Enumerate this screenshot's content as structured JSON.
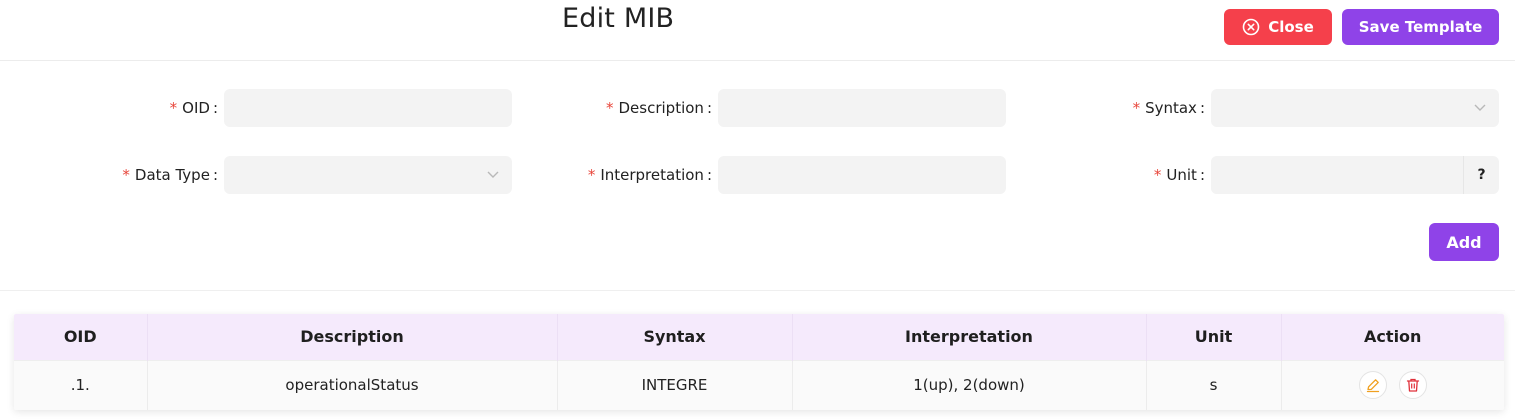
{
  "header": {
    "title": "Edit MIB",
    "close_label": "Close",
    "save_label": "Save Template"
  },
  "form": {
    "oid": {
      "label": "OID",
      "value": ""
    },
    "description": {
      "label": "Description",
      "value": ""
    },
    "syntax": {
      "label": "Syntax",
      "value": ""
    },
    "data_type": {
      "label": "Data Type",
      "value": ""
    },
    "interpretation": {
      "label": "Interpretation",
      "value": ""
    },
    "unit": {
      "label": "Unit",
      "value": "",
      "suffix": "?"
    },
    "required_mark": "*",
    "add_label": "Add"
  },
  "table": {
    "columns": [
      "OID",
      "Description",
      "Syntax",
      "Interpretation",
      "Unit",
      "Action"
    ],
    "rows": [
      {
        "oid": ".1.",
        "description": "operationalStatus",
        "syntax": "INTEGRE",
        "interpretation": "1(up), 2(down)",
        "unit": "s"
      }
    ]
  },
  "colors": {
    "danger": "#f5404b",
    "primary": "#8f43e8",
    "header_bg": "#f5eafc",
    "edit_icon": "#f0a020",
    "delete_icon": "#e0303a"
  },
  "icons": {
    "close": "close-circle-icon",
    "select": "chevron-down-icon",
    "edit": "edit-icon",
    "delete": "trash-icon"
  }
}
